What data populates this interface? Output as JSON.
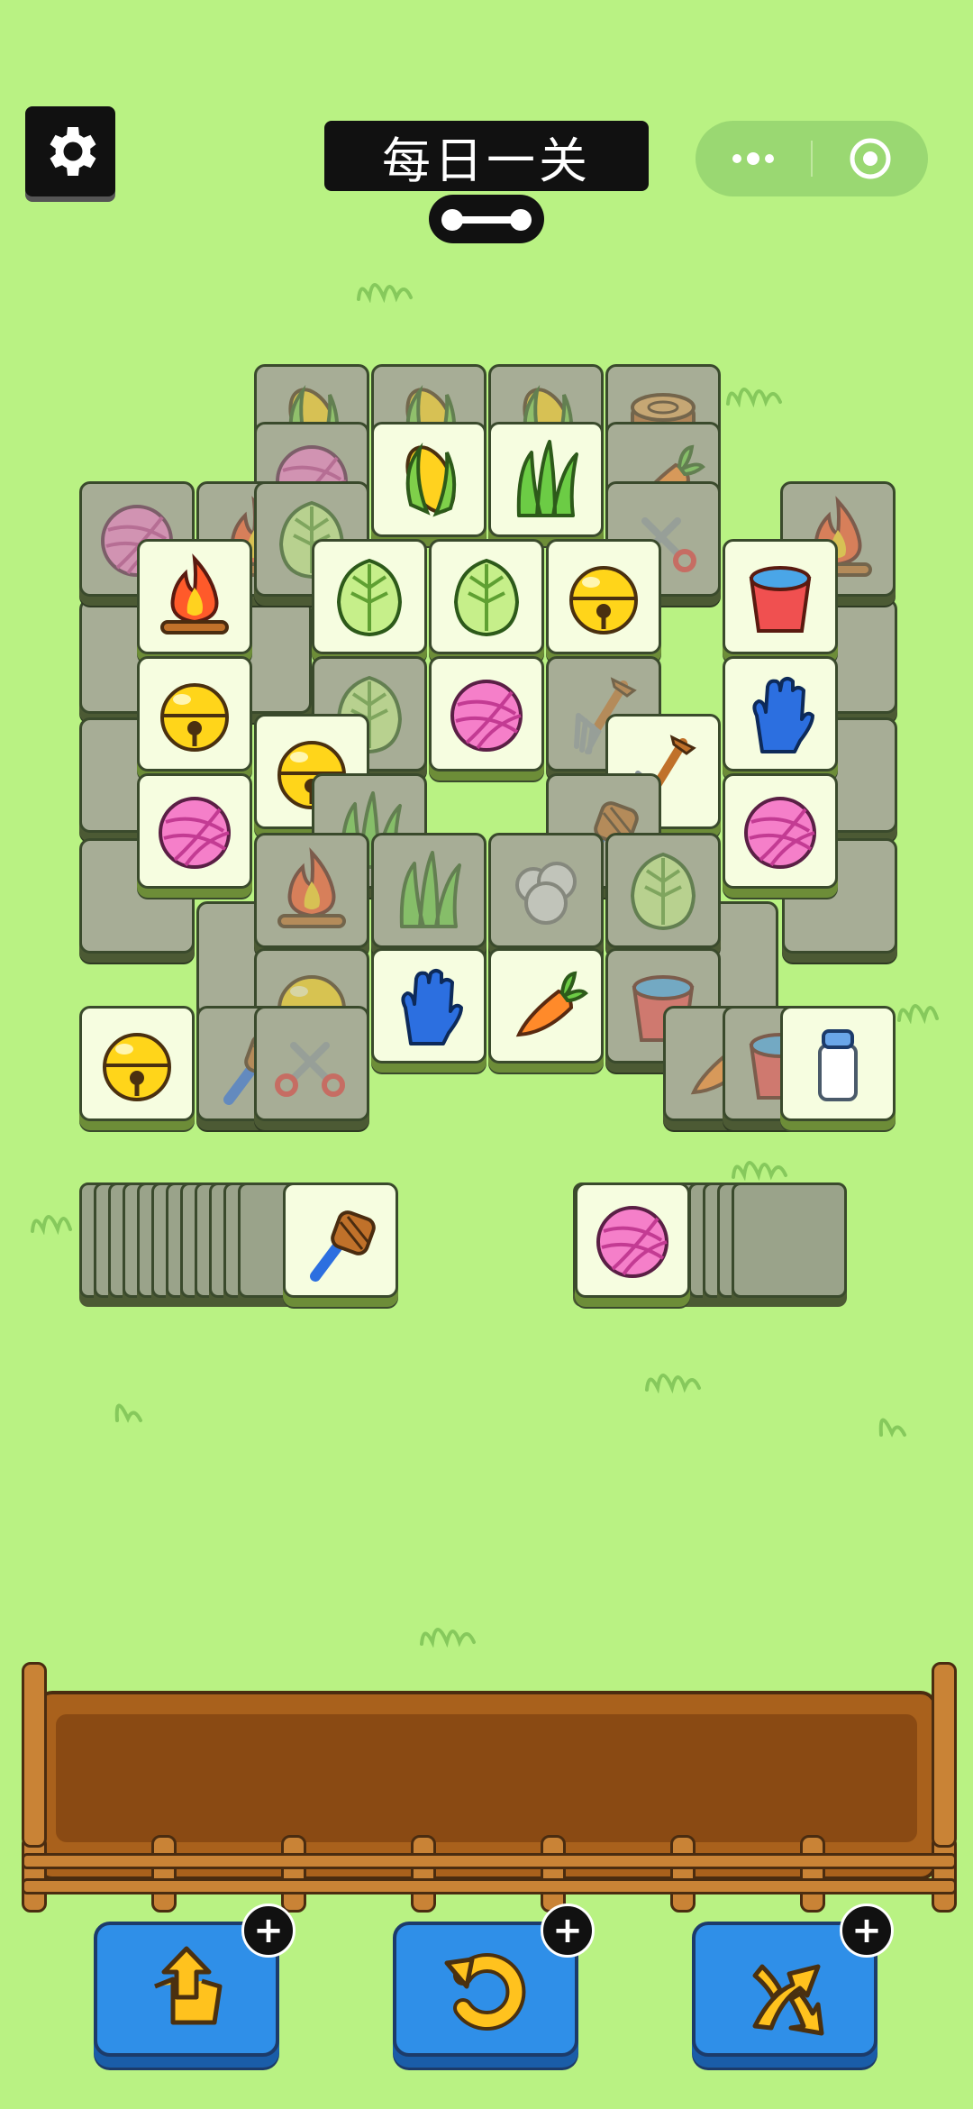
{
  "header": {
    "title": "每日一关",
    "settings_icon": "gear-icon",
    "more_icon": "more-dots-icon",
    "close_icon": "target-close-icon"
  },
  "board": {
    "tiles": [
      {
        "icon": "corn",
        "state": "dim"
      },
      {
        "icon": "corn",
        "state": "dim"
      },
      {
        "icon": "corn",
        "state": "dim"
      },
      {
        "icon": "stump",
        "state": "dim"
      },
      {
        "icon": "yarn",
        "state": "dim"
      },
      {
        "icon": "corn",
        "state": "open"
      },
      {
        "icon": "grass",
        "state": "open"
      },
      {
        "icon": "carrot",
        "state": "dim"
      },
      {
        "icon": "yarn",
        "state": "dim"
      },
      {
        "icon": "fire",
        "state": "dim"
      },
      {
        "icon": "cabbage",
        "state": "dim"
      },
      {
        "icon": "shears",
        "state": "dim"
      },
      {
        "icon": "fire",
        "state": "dim"
      },
      {
        "icon": "fire",
        "state": "open"
      },
      {
        "icon": "cabbage",
        "state": "open"
      },
      {
        "icon": "cabbage",
        "state": "open"
      },
      {
        "icon": "bell",
        "state": "open"
      },
      {
        "icon": "bucket",
        "state": "open"
      },
      {
        "icon": "bell",
        "state": "open"
      },
      {
        "icon": "cabbage",
        "state": "dim"
      },
      {
        "icon": "yarn",
        "state": "open"
      },
      {
        "icon": "fork",
        "state": "dim"
      },
      {
        "icon": "glove",
        "state": "open"
      },
      {
        "icon": "bell",
        "state": "open"
      },
      {
        "icon": "fork",
        "state": "open"
      },
      {
        "icon": "yarn",
        "state": "open"
      },
      {
        "icon": "grass",
        "state": "dim"
      },
      {
        "icon": "brush",
        "state": "dim"
      },
      {
        "icon": "yarn",
        "state": "open"
      },
      {
        "icon": "fire",
        "state": "dim"
      },
      {
        "icon": "grass",
        "state": "dim"
      },
      {
        "icon": "wool",
        "state": "dim"
      },
      {
        "icon": "cabbage",
        "state": "dim"
      },
      {
        "icon": "bell",
        "state": "dim"
      },
      {
        "icon": "glove",
        "state": "open"
      },
      {
        "icon": "carrot",
        "state": "open"
      },
      {
        "icon": "bucket",
        "state": "dim"
      },
      {
        "icon": "bell",
        "state": "open"
      },
      {
        "icon": "brush",
        "state": "dim"
      },
      {
        "icon": "shears",
        "state": "dim"
      },
      {
        "icon": "carrot",
        "state": "dim"
      },
      {
        "icon": "bucket",
        "state": "dim"
      },
      {
        "icon": "milk",
        "state": "open"
      }
    ]
  },
  "left_stack": {
    "top_icon": "brush"
  },
  "right_stack": {
    "top_icon": "yarn"
  },
  "tray": {
    "slots_filled": 0
  },
  "tools": [
    {
      "icon": "move-out-icon",
      "badge": "+"
    },
    {
      "icon": "undo-icon",
      "badge": "+"
    },
    {
      "icon": "shuffle-icon",
      "badge": "+"
    }
  ],
  "colors": {
    "background": "#b9f283",
    "tile": "#f6fde0",
    "button": "#2f8fe8",
    "tray": "#a9611c"
  }
}
